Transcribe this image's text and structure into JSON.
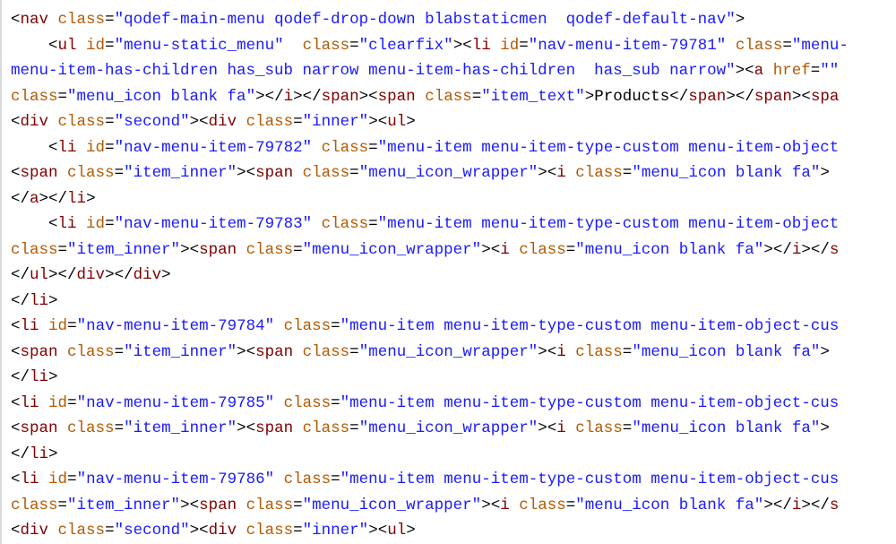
{
  "code_lines": [
    [
      {
        "cls": "p",
        "t": "<"
      },
      {
        "cls": "t",
        "t": "nav"
      },
      {
        "cls": "p",
        "t": " "
      },
      {
        "cls": "a",
        "t": "class"
      },
      {
        "cls": "p",
        "t": "="
      },
      {
        "cls": "v",
        "t": "\"qodef-main-menu qodef-drop-down blabstaticmen  qodef-default-nav\""
      },
      {
        "cls": "p",
        "t": ">"
      }
    ],
    [
      {
        "cls": "p",
        "t": "    <"
      },
      {
        "cls": "t",
        "t": "ul"
      },
      {
        "cls": "p",
        "t": " "
      },
      {
        "cls": "a",
        "t": "id"
      },
      {
        "cls": "p",
        "t": "="
      },
      {
        "cls": "v",
        "t": "\"menu-static_menu\""
      },
      {
        "cls": "p",
        "t": "  "
      },
      {
        "cls": "a",
        "t": "class"
      },
      {
        "cls": "p",
        "t": "="
      },
      {
        "cls": "v",
        "t": "\"clearfix\""
      },
      {
        "cls": "p",
        "t": "><"
      },
      {
        "cls": "t",
        "t": "li"
      },
      {
        "cls": "p",
        "t": " "
      },
      {
        "cls": "a",
        "t": "id"
      },
      {
        "cls": "p",
        "t": "="
      },
      {
        "cls": "v",
        "t": "\"nav-menu-item-79781\""
      },
      {
        "cls": "p",
        "t": " "
      },
      {
        "cls": "a",
        "t": "class"
      },
      {
        "cls": "p",
        "t": "="
      },
      {
        "cls": "v",
        "t": "\"menu-"
      }
    ],
    [
      {
        "cls": "v",
        "t": "menu-item-has-children has_sub narrow menu-item-has-children  has_sub narrow\""
      },
      {
        "cls": "p",
        "t": "><"
      },
      {
        "cls": "t",
        "t": "a"
      },
      {
        "cls": "p",
        "t": " "
      },
      {
        "cls": "a",
        "t": "href"
      },
      {
        "cls": "p",
        "t": "="
      },
      {
        "cls": "v",
        "t": "\"\""
      }
    ],
    [
      {
        "cls": "a",
        "t": "class"
      },
      {
        "cls": "p",
        "t": "="
      },
      {
        "cls": "v",
        "t": "\"menu_icon blank fa\""
      },
      {
        "cls": "p",
        "t": "></"
      },
      {
        "cls": "t",
        "t": "i"
      },
      {
        "cls": "p",
        "t": "></"
      },
      {
        "cls": "t",
        "t": "span"
      },
      {
        "cls": "p",
        "t": "><"
      },
      {
        "cls": "t",
        "t": "span"
      },
      {
        "cls": "p",
        "t": " "
      },
      {
        "cls": "a",
        "t": "class"
      },
      {
        "cls": "p",
        "t": "="
      },
      {
        "cls": "v",
        "t": "\"item_text\""
      },
      {
        "cls": "p",
        "t": ">"
      },
      {
        "cls": "x",
        "t": "Products"
      },
      {
        "cls": "p",
        "t": "</"
      },
      {
        "cls": "t",
        "t": "span"
      },
      {
        "cls": "p",
        "t": "></"
      },
      {
        "cls": "t",
        "t": "span"
      },
      {
        "cls": "p",
        "t": "><"
      },
      {
        "cls": "t",
        "t": "spa"
      }
    ],
    [
      {
        "cls": "p",
        "t": "<"
      },
      {
        "cls": "t",
        "t": "div"
      },
      {
        "cls": "p",
        "t": " "
      },
      {
        "cls": "a",
        "t": "class"
      },
      {
        "cls": "p",
        "t": "="
      },
      {
        "cls": "v",
        "t": "\"second\""
      },
      {
        "cls": "p",
        "t": "><"
      },
      {
        "cls": "t",
        "t": "div"
      },
      {
        "cls": "p",
        "t": " "
      },
      {
        "cls": "a",
        "t": "class"
      },
      {
        "cls": "p",
        "t": "="
      },
      {
        "cls": "v",
        "t": "\"inner\""
      },
      {
        "cls": "p",
        "t": "><"
      },
      {
        "cls": "t",
        "t": "ul"
      },
      {
        "cls": "p",
        "t": ">"
      }
    ],
    [
      {
        "cls": "p",
        "t": "    <"
      },
      {
        "cls": "t",
        "t": "li"
      },
      {
        "cls": "p",
        "t": " "
      },
      {
        "cls": "a",
        "t": "id"
      },
      {
        "cls": "p",
        "t": "="
      },
      {
        "cls": "v",
        "t": "\"nav-menu-item-79782\""
      },
      {
        "cls": "p",
        "t": " "
      },
      {
        "cls": "a",
        "t": "class"
      },
      {
        "cls": "p",
        "t": "="
      },
      {
        "cls": "v",
        "t": "\"menu-item menu-item-type-custom menu-item-object"
      }
    ],
    [
      {
        "cls": "p",
        "t": "<"
      },
      {
        "cls": "t",
        "t": "span"
      },
      {
        "cls": "p",
        "t": " "
      },
      {
        "cls": "a",
        "t": "class"
      },
      {
        "cls": "p",
        "t": "="
      },
      {
        "cls": "v",
        "t": "\"item_inner\""
      },
      {
        "cls": "p",
        "t": "><"
      },
      {
        "cls": "t",
        "t": "span"
      },
      {
        "cls": "p",
        "t": " "
      },
      {
        "cls": "a",
        "t": "class"
      },
      {
        "cls": "p",
        "t": "="
      },
      {
        "cls": "v",
        "t": "\"menu_icon_wrapper\""
      },
      {
        "cls": "p",
        "t": "><"
      },
      {
        "cls": "t",
        "t": "i"
      },
      {
        "cls": "p",
        "t": " "
      },
      {
        "cls": "a",
        "t": "class"
      },
      {
        "cls": "p",
        "t": "="
      },
      {
        "cls": "v",
        "t": "\"menu_icon blank fa\""
      },
      {
        "cls": "p",
        "t": ">"
      }
    ],
    [
      {
        "cls": "p",
        "t": "</"
      },
      {
        "cls": "t",
        "t": "a"
      },
      {
        "cls": "p",
        "t": "></"
      },
      {
        "cls": "t",
        "t": "li"
      },
      {
        "cls": "p",
        "t": ">"
      }
    ],
    [
      {
        "cls": "p",
        "t": "    <"
      },
      {
        "cls": "t",
        "t": "li"
      },
      {
        "cls": "p",
        "t": " "
      },
      {
        "cls": "a",
        "t": "id"
      },
      {
        "cls": "p",
        "t": "="
      },
      {
        "cls": "v",
        "t": "\"nav-menu-item-79783\""
      },
      {
        "cls": "p",
        "t": " "
      },
      {
        "cls": "a",
        "t": "class"
      },
      {
        "cls": "p",
        "t": "="
      },
      {
        "cls": "v",
        "t": "\"menu-item menu-item-type-custom menu-item-object"
      }
    ],
    [
      {
        "cls": "a",
        "t": "class"
      },
      {
        "cls": "p",
        "t": "="
      },
      {
        "cls": "v",
        "t": "\"item_inner\""
      },
      {
        "cls": "p",
        "t": "><"
      },
      {
        "cls": "t",
        "t": "span"
      },
      {
        "cls": "p",
        "t": " "
      },
      {
        "cls": "a",
        "t": "class"
      },
      {
        "cls": "p",
        "t": "="
      },
      {
        "cls": "v",
        "t": "\"menu_icon_wrapper\""
      },
      {
        "cls": "p",
        "t": "><"
      },
      {
        "cls": "t",
        "t": "i"
      },
      {
        "cls": "p",
        "t": " "
      },
      {
        "cls": "a",
        "t": "class"
      },
      {
        "cls": "p",
        "t": "="
      },
      {
        "cls": "v",
        "t": "\"menu_icon blank fa\""
      },
      {
        "cls": "p",
        "t": "></"
      },
      {
        "cls": "t",
        "t": "i"
      },
      {
        "cls": "p",
        "t": "></"
      },
      {
        "cls": "t",
        "t": "s"
      }
    ],
    [
      {
        "cls": "p",
        "t": "</"
      },
      {
        "cls": "t",
        "t": "ul"
      },
      {
        "cls": "p",
        "t": "></"
      },
      {
        "cls": "t",
        "t": "div"
      },
      {
        "cls": "p",
        "t": "></"
      },
      {
        "cls": "t",
        "t": "div"
      },
      {
        "cls": "p",
        "t": ">"
      }
    ],
    [
      {
        "cls": "p",
        "t": "</"
      },
      {
        "cls": "t",
        "t": "li"
      },
      {
        "cls": "p",
        "t": ">"
      }
    ],
    [
      {
        "cls": "p",
        "t": "<"
      },
      {
        "cls": "t",
        "t": "li"
      },
      {
        "cls": "p",
        "t": " "
      },
      {
        "cls": "a",
        "t": "id"
      },
      {
        "cls": "p",
        "t": "="
      },
      {
        "cls": "v",
        "t": "\"nav-menu-item-79784\""
      },
      {
        "cls": "p",
        "t": " "
      },
      {
        "cls": "a",
        "t": "class"
      },
      {
        "cls": "p",
        "t": "="
      },
      {
        "cls": "v",
        "t": "\"menu-item menu-item-type-custom menu-item-object-cus"
      }
    ],
    [
      {
        "cls": "p",
        "t": "<"
      },
      {
        "cls": "t",
        "t": "span"
      },
      {
        "cls": "p",
        "t": " "
      },
      {
        "cls": "a",
        "t": "class"
      },
      {
        "cls": "p",
        "t": "="
      },
      {
        "cls": "v",
        "t": "\"item_inner\""
      },
      {
        "cls": "p",
        "t": "><"
      },
      {
        "cls": "t",
        "t": "span"
      },
      {
        "cls": "p",
        "t": " "
      },
      {
        "cls": "a",
        "t": "class"
      },
      {
        "cls": "p",
        "t": "="
      },
      {
        "cls": "v",
        "t": "\"menu_icon_wrapper\""
      },
      {
        "cls": "p",
        "t": "><"
      },
      {
        "cls": "t",
        "t": "i"
      },
      {
        "cls": "p",
        "t": " "
      },
      {
        "cls": "a",
        "t": "class"
      },
      {
        "cls": "p",
        "t": "="
      },
      {
        "cls": "v",
        "t": "\"menu_icon blank fa\""
      },
      {
        "cls": "p",
        "t": ">"
      }
    ],
    [
      {
        "cls": "p",
        "t": "</"
      },
      {
        "cls": "t",
        "t": "li"
      },
      {
        "cls": "p",
        "t": ">"
      }
    ],
    [
      {
        "cls": "p",
        "t": "<"
      },
      {
        "cls": "t",
        "t": "li"
      },
      {
        "cls": "p",
        "t": " "
      },
      {
        "cls": "a",
        "t": "id"
      },
      {
        "cls": "p",
        "t": "="
      },
      {
        "cls": "v",
        "t": "\"nav-menu-item-79785\""
      },
      {
        "cls": "p",
        "t": " "
      },
      {
        "cls": "a",
        "t": "class"
      },
      {
        "cls": "p",
        "t": "="
      },
      {
        "cls": "v",
        "t": "\"menu-item menu-item-type-custom menu-item-object-cus"
      }
    ],
    [
      {
        "cls": "p",
        "t": "<"
      },
      {
        "cls": "t",
        "t": "span"
      },
      {
        "cls": "p",
        "t": " "
      },
      {
        "cls": "a",
        "t": "class"
      },
      {
        "cls": "p",
        "t": "="
      },
      {
        "cls": "v",
        "t": "\"item_inner\""
      },
      {
        "cls": "p",
        "t": "><"
      },
      {
        "cls": "t",
        "t": "span"
      },
      {
        "cls": "p",
        "t": " "
      },
      {
        "cls": "a",
        "t": "class"
      },
      {
        "cls": "p",
        "t": "="
      },
      {
        "cls": "v",
        "t": "\"menu_icon_wrapper\""
      },
      {
        "cls": "p",
        "t": "><"
      },
      {
        "cls": "t",
        "t": "i"
      },
      {
        "cls": "p",
        "t": " "
      },
      {
        "cls": "a",
        "t": "class"
      },
      {
        "cls": "p",
        "t": "="
      },
      {
        "cls": "v",
        "t": "\"menu_icon blank fa\""
      },
      {
        "cls": "p",
        "t": ">"
      }
    ],
    [
      {
        "cls": "p",
        "t": "</"
      },
      {
        "cls": "t",
        "t": "li"
      },
      {
        "cls": "p",
        "t": ">"
      }
    ],
    [
      {
        "cls": "p",
        "t": "<"
      },
      {
        "cls": "t",
        "t": "li"
      },
      {
        "cls": "p",
        "t": " "
      },
      {
        "cls": "a",
        "t": "id"
      },
      {
        "cls": "p",
        "t": "="
      },
      {
        "cls": "v",
        "t": "\"nav-menu-item-79786\""
      },
      {
        "cls": "p",
        "t": " "
      },
      {
        "cls": "a",
        "t": "class"
      },
      {
        "cls": "p",
        "t": "="
      },
      {
        "cls": "v",
        "t": "\"menu-item menu-item-type-custom menu-item-object-cus"
      }
    ],
    [
      {
        "cls": "a",
        "t": "class"
      },
      {
        "cls": "p",
        "t": "="
      },
      {
        "cls": "v",
        "t": "\"item_inner\""
      },
      {
        "cls": "p",
        "t": "><"
      },
      {
        "cls": "t",
        "t": "span"
      },
      {
        "cls": "p",
        "t": " "
      },
      {
        "cls": "a",
        "t": "class"
      },
      {
        "cls": "p",
        "t": "="
      },
      {
        "cls": "v",
        "t": "\"menu_icon_wrapper\""
      },
      {
        "cls": "p",
        "t": "><"
      },
      {
        "cls": "t",
        "t": "i"
      },
      {
        "cls": "p",
        "t": " "
      },
      {
        "cls": "a",
        "t": "class"
      },
      {
        "cls": "p",
        "t": "="
      },
      {
        "cls": "v",
        "t": "\"menu_icon blank fa\""
      },
      {
        "cls": "p",
        "t": "></"
      },
      {
        "cls": "t",
        "t": "i"
      },
      {
        "cls": "p",
        "t": "></"
      },
      {
        "cls": "t",
        "t": "s"
      }
    ],
    [
      {
        "cls": "p",
        "t": "<"
      },
      {
        "cls": "t",
        "t": "div"
      },
      {
        "cls": "p",
        "t": " "
      },
      {
        "cls": "a",
        "t": "class"
      },
      {
        "cls": "p",
        "t": "="
      },
      {
        "cls": "v",
        "t": "\"second\""
      },
      {
        "cls": "p",
        "t": "><"
      },
      {
        "cls": "t",
        "t": "div"
      },
      {
        "cls": "p",
        "t": " "
      },
      {
        "cls": "a",
        "t": "class"
      },
      {
        "cls": "p",
        "t": "="
      },
      {
        "cls": "v",
        "t": "\"inner\""
      },
      {
        "cls": "p",
        "t": "><"
      },
      {
        "cls": "t",
        "t": "ul"
      },
      {
        "cls": "p",
        "t": ">"
      }
    ]
  ]
}
